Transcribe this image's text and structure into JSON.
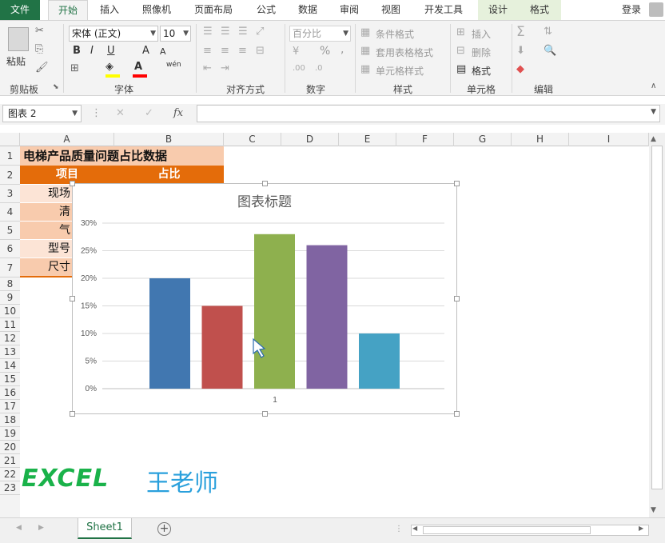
{
  "tabs": {
    "file": "文件",
    "home": "开始",
    "insert": "插入",
    "photo": "照像机",
    "layout": "页面布局",
    "formula": "公式",
    "data": "数据",
    "review": "审阅",
    "view": "视图",
    "dev": "开发工具",
    "design": "设计",
    "format": "格式",
    "login": "登录"
  },
  "ribbon": {
    "clipboard": {
      "paste": "粘贴",
      "label": "剪贴板"
    },
    "font": {
      "name": "宋体 (正文)",
      "size": "10",
      "bold": "B",
      "italic": "I",
      "underline": "U",
      "grow": "A",
      "shrink": "A",
      "wen": "wén",
      "label": "字体"
    },
    "align": {
      "label": "对齐方式"
    },
    "number": {
      "format": "百分比",
      "percent": "%",
      "comma": ",",
      "label": "数字"
    },
    "styles": {
      "cond": "条件格式",
      "table": "套用表格格式",
      "cell": "单元格样式",
      "label": "样式"
    },
    "cells": {
      "insert": "插入",
      "delete": "删除",
      "format": "格式",
      "label": "单元格"
    },
    "edit": {
      "label": "编辑"
    }
  },
  "formula": {
    "namebox": "图表 2",
    "fx": "fx",
    "cancel": "✕",
    "enter": "✓"
  },
  "columns": [
    "A",
    "B",
    "C",
    "D",
    "E",
    "F",
    "G",
    "H",
    "I"
  ],
  "rows": [
    "1",
    "2",
    "3",
    "4",
    "5",
    "6",
    "7",
    "8",
    "9",
    "10",
    "11",
    "12",
    "13",
    "14",
    "15",
    "16",
    "17",
    "18",
    "19",
    "20",
    "21",
    "22",
    "23"
  ],
  "cells": {
    "title": "电梯产品质量问题占比数据",
    "h_item": "项目",
    "h_ratio": "占比",
    "r3": "现场",
    "r4": "清",
    "r5": "气",
    "r6": "型号",
    "r7": "尺寸"
  },
  "watermark": {
    "excel": "EXCEL",
    "name": "王老师"
  },
  "sheet": {
    "name": "Sheet1",
    "add": "+"
  },
  "chart_data": {
    "type": "bar",
    "title": "图表标题",
    "categories": [
      "1"
    ],
    "series": [
      {
        "values": [
          0.2
        ],
        "color": "#4177b0"
      },
      {
        "values": [
          0.15
        ],
        "color": "#c0504d"
      },
      {
        "values": [
          0.28
        ],
        "color": "#8eb04e"
      },
      {
        "values": [
          0.26
        ],
        "color": "#8064a2"
      },
      {
        "values": [
          0.1
        ],
        "color": "#45a2c4"
      }
    ],
    "yticks": [
      "0%",
      "5%",
      "10%",
      "15%",
      "20%",
      "25%",
      "30%"
    ],
    "ylim": [
      0,
      0.3
    ],
    "grid": true
  }
}
